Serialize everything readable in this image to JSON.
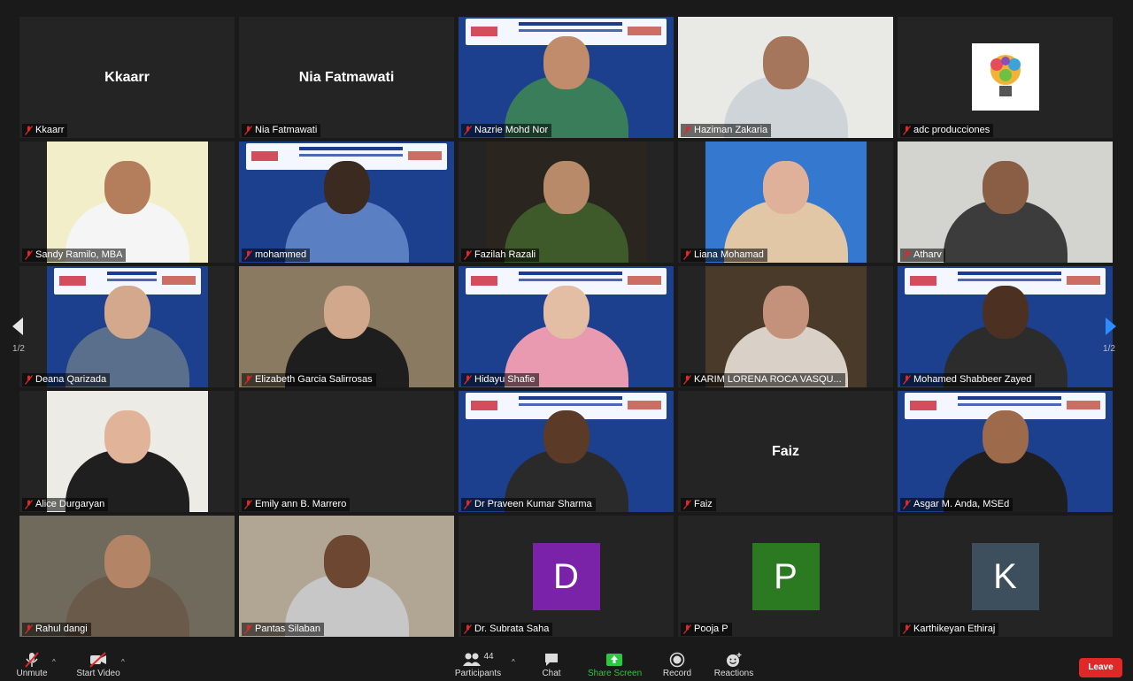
{
  "participants_grid": [
    {
      "name": "Kkaarr",
      "mode": "name"
    },
    {
      "name": "Nia Fatmawati",
      "mode": "name"
    },
    {
      "name": "Nazrie Mohd Nor",
      "mode": "video",
      "bg": "#1c3f8e",
      "skin": "#c08c6c",
      "shirt": "#3a7d5a",
      "banner": true
    },
    {
      "name": "Haziman Zakaria",
      "mode": "video",
      "bg": "#e9e9e6",
      "skin": "#a5765b",
      "shirt": "#cfd4d8"
    },
    {
      "name": "adc producciones",
      "mode": "logo"
    },
    {
      "name": "Sandy Ramilo, MBA",
      "mode": "video",
      "bg": "#f1eec9",
      "skin": "#b47e5c",
      "shirt": "#f5f5f5",
      "narrow": true
    },
    {
      "name": "mohammed",
      "mode": "video",
      "bg": "#1c3f8e",
      "skin": "#3a2a20",
      "shirt": "#5b7fc3",
      "banner": true
    },
    {
      "name": "Fazilah Razali",
      "mode": "video",
      "bg": "#2b2520",
      "skin": "#b88a6a",
      "shirt": "#3e5a2b",
      "narrow": true
    },
    {
      "name": "Liana Mohamad",
      "mode": "video",
      "bg": "#3478d0",
      "skin": "#e0b19a",
      "shirt": "#e1c7a6",
      "narrow": true
    },
    {
      "name": "Atharv",
      "mode": "video",
      "bg": "#d3d3cf",
      "skin": "#8a5d45",
      "shirt": "#3c3c3c"
    },
    {
      "name": "Deana Qarizada",
      "mode": "video",
      "bg": "#1c3f8e",
      "skin": "#d4a88d",
      "shirt": "#5a6f8c",
      "banner": true,
      "narrow": true
    },
    {
      "name": "Elizabeth Garcia Salirrosas",
      "mode": "video",
      "bg": "#8b7a62",
      "skin": "#d1a88c",
      "shirt": "#1e1e1e"
    },
    {
      "name": "Hidayu Shafie",
      "mode": "video",
      "bg": "#1c3f8e",
      "skin": "#e4bea4",
      "shirt": "#e99ab0",
      "banner": true
    },
    {
      "name": "KARIM LORENA ROCA VASQU...",
      "mode": "video",
      "bg": "#4a3a2a",
      "skin": "#c4917a",
      "shirt": "#d9d0c8",
      "narrow": true
    },
    {
      "name": "Mohamed Shabbeer Zayed",
      "mode": "video",
      "bg": "#1c3f8e",
      "skin": "#4c3122",
      "shirt": "#2c2c2c",
      "banner": true
    },
    {
      "name": "Alice Durgaryan",
      "mode": "video",
      "bg": "#ecebe6",
      "skin": "#e1b49a",
      "shirt": "#1f1f1f",
      "narrow": true
    },
    {
      "name": "Emily ann B. Marrero",
      "mode": "blank"
    },
    {
      "name": "Dr Praveen Kumar Sharma",
      "mode": "video",
      "bg": "#1c3f8e",
      "skin": "#5b3a28",
      "shirt": "#2a2a2a",
      "banner": true
    },
    {
      "name": "Faiz",
      "mode": "name"
    },
    {
      "name": "Asgar M. Anda, MSEd",
      "mode": "video",
      "bg": "#1c3f8e",
      "skin": "#9d6a4c",
      "shirt": "#1e1e1e",
      "banner": true
    },
    {
      "name": "Rahul dangi",
      "mode": "video",
      "bg": "#6f6a5c",
      "skin": "#b48466",
      "shirt": "#6a5a4a"
    },
    {
      "name": "Pantas Silaban",
      "mode": "video",
      "bg": "#b1a594",
      "skin": "#6e4732",
      "shirt": "#c7c7c7"
    },
    {
      "name": "Dr. Subrata Saha",
      "mode": "avatar",
      "letter": "D",
      "color": "#7a22a8"
    },
    {
      "name": "Pooja P",
      "mode": "avatar",
      "letter": "P",
      "color": "#2b7a22"
    },
    {
      "name": "Karthikeyan Ethiraj",
      "mode": "avatar",
      "letter": "K",
      "color": "#3d4e5c"
    }
  ],
  "pager": {
    "left": "1/2",
    "right": "1/2"
  },
  "toolbar": {
    "unmute": "Unmute",
    "start_video": "Start Video",
    "participants": "Participants",
    "participants_count": "44",
    "chat": "Chat",
    "share_screen": "Share Screen",
    "record": "Record",
    "reactions": "Reactions",
    "leave": "Leave"
  },
  "colors": {
    "share_screen": "#2ec83f",
    "leave": "#e02828",
    "banner_blue": "#1c3f8e"
  }
}
